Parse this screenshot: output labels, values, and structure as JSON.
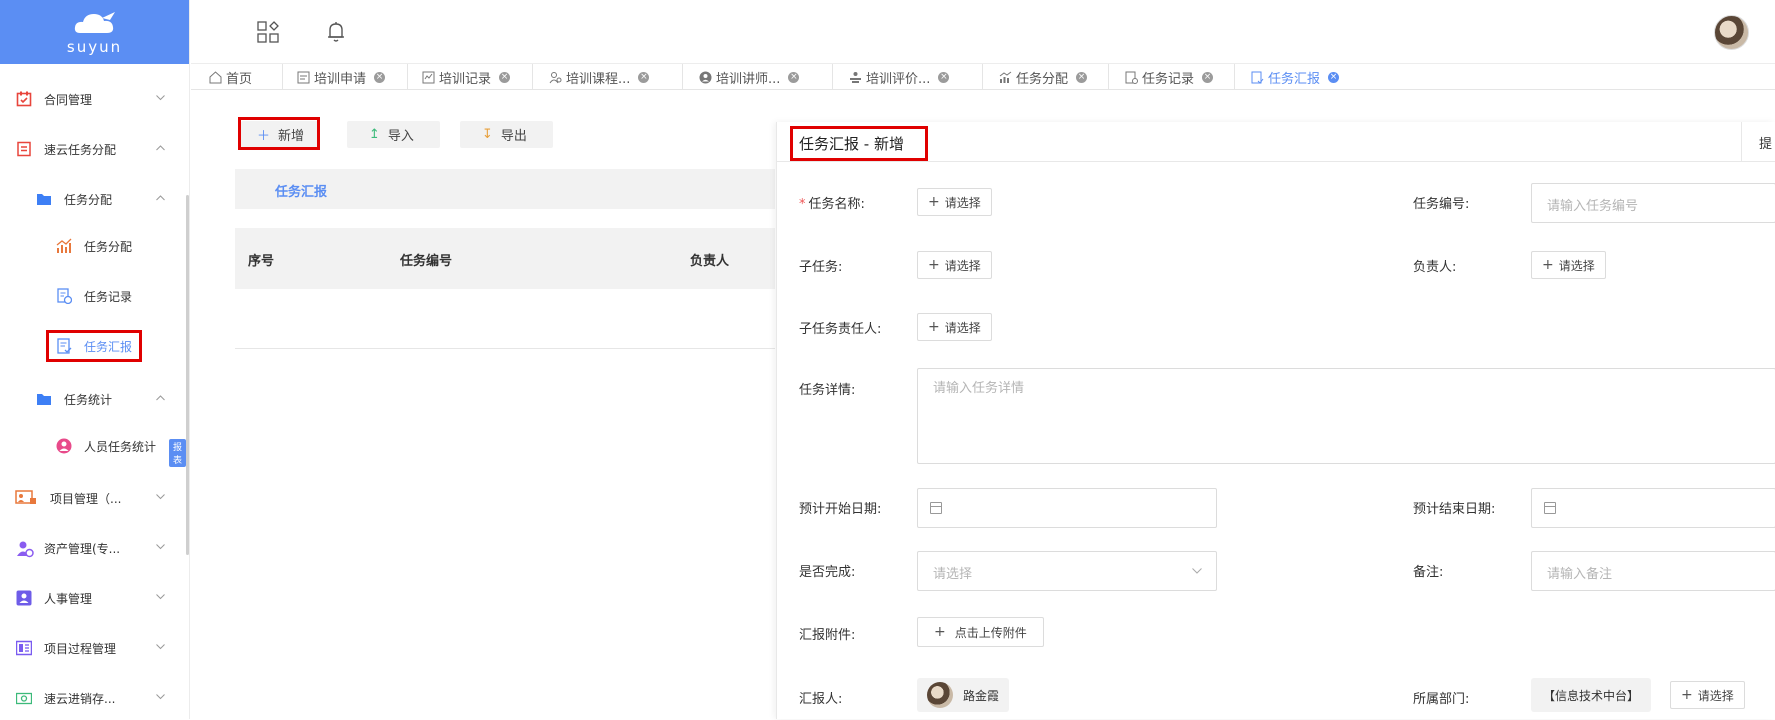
{
  "brand": {
    "name": "suyun"
  },
  "sidebar": {
    "items": [
      {
        "label": "合同管理",
        "icon": "contract-icon",
        "color": "#e8453c"
      },
      {
        "label": "速云任务分配",
        "icon": "task-list-icon",
        "color": "#e8453c"
      },
      {
        "label": "任务分配",
        "icon": "folder-icon",
        "color": "#3d7ff5"
      },
      {
        "label": "任务分配",
        "icon": "chart-icon",
        "color": "#e8783c"
      },
      {
        "label": "任务记录",
        "icon": "record-icon",
        "color": "#5b8ef3"
      },
      {
        "label": "任务汇报",
        "icon": "report-icon",
        "color": "#5b8ef3"
      },
      {
        "label": "任务统计",
        "icon": "folder-icon",
        "color": "#3d7ff5"
      },
      {
        "label": "人员任务统计",
        "icon": "person-icon",
        "color": "#e84a8a",
        "badge": "报表"
      },
      {
        "label": "项目管理（...",
        "icon": "project-icon",
        "color": "#e8783c"
      },
      {
        "label": "资产管理(专...",
        "icon": "asset-icon",
        "color": "#8a5cf0"
      },
      {
        "label": "人事管理",
        "icon": "hr-icon",
        "color": "#6e5ce8"
      },
      {
        "label": "项目过程管理",
        "icon": "process-icon",
        "color": "#7a5cf0"
      },
      {
        "label": "速云进销存...",
        "icon": "inventory-icon",
        "color": "#3cba7a"
      }
    ]
  },
  "tabs": [
    {
      "label": "首页",
      "icon": "home-icon"
    },
    {
      "label": "培训申请",
      "icon": "apply-icon"
    },
    {
      "label": "培训记录",
      "icon": "record-icon"
    },
    {
      "label": "培训课程...",
      "icon": "course-icon"
    },
    {
      "label": "培训讲师...",
      "icon": "teacher-icon"
    },
    {
      "label": "培训评价...",
      "icon": "evaluate-icon"
    },
    {
      "label": "任务分配",
      "icon": "chart-icon"
    },
    {
      "label": "任务记录",
      "icon": "record-icon"
    },
    {
      "label": "任务汇报",
      "icon": "report-icon"
    }
  ],
  "toolbar": {
    "add": "新增",
    "import": "导入",
    "export": "导出"
  },
  "list": {
    "section_title": "任务汇报",
    "columns": [
      "序号",
      "任务编号",
      "负责人"
    ]
  },
  "form": {
    "title": "任务汇报  -  新增",
    "submit_label": "提",
    "task_name_label": "任务名称:",
    "task_no_label": "任务编号:",
    "task_no_placeholder": "请输入任务编号",
    "subtask_label": "子任务:",
    "owner_label": "负责人:",
    "subtask_owner_label": "子任务责任人:",
    "detail_label": "任务详情:",
    "detail_placeholder": "请输入任务详情",
    "start_label": "预计开始日期:",
    "end_label": "预计结束日期:",
    "done_label": "是否完成:",
    "done_placeholder": "请选择",
    "remark_label": "备注:",
    "remark_placeholder": "请输入备注",
    "attach_label": "汇报附件:",
    "attach_btn": "点击上传附件",
    "reporter_label": "汇报人:",
    "reporter_name": "路金霞",
    "dept_label": "所属部门:",
    "dept_value": "【信息技术中台】",
    "pick": "请选择"
  },
  "colors": {
    "accent": "#5b8ef3",
    "highlight": "#e00000"
  }
}
